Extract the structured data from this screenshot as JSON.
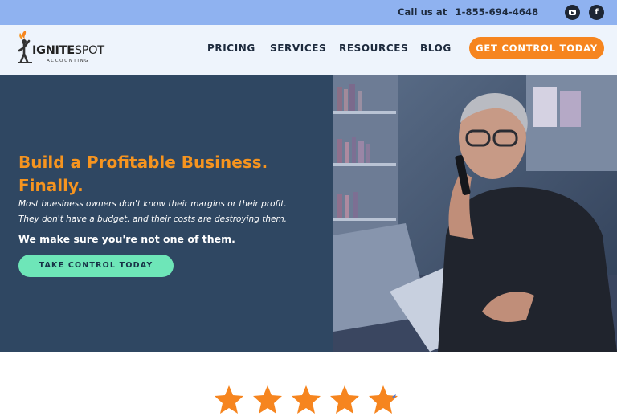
{
  "topbar": {
    "call_label": "Call us at",
    "phone": "1-855-694-4648",
    "social": [
      "youtube-icon",
      "facebook-icon"
    ],
    "facebook_glyph": "f"
  },
  "nav": {
    "logo": {
      "brand_a": "IGNITE",
      "brand_b": "SPOT",
      "sub": "ACCOUNTING"
    },
    "items": [
      "PRICING",
      "SERVICES",
      "RESOURCES",
      "BLOG"
    ],
    "cta": "GET CONTROL TODAY"
  },
  "hero": {
    "headline_line1": "Build a Profitable Business.",
    "headline_line2": "Finally.",
    "desc_line1": "Most buesiness owners don't know  their margins or their profit.",
    "desc_line2": "They don't have a budget, and their costs are destroying them.",
    "emphasis": "We make sure you're not one of them.",
    "cta": "TAKE CONTROL TODAY"
  },
  "rating": {
    "stars": 5
  },
  "colors": {
    "topbar": "#8fb2f0",
    "nav_bg": "#eef4fc",
    "hero_bg": "#2f4762",
    "accent_orange": "#f6851f",
    "headline": "#f6941f",
    "cta_green": "#6ee6b8"
  }
}
